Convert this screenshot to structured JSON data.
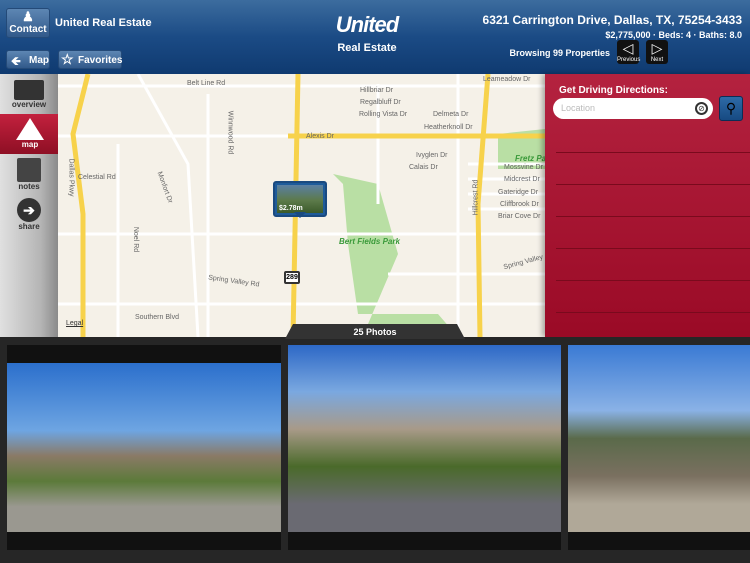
{
  "header": {
    "contact_label": "Contact",
    "agent_name": "United Real Estate",
    "map_label": "Map",
    "favorites_label": "Favorites",
    "logo_line1": "United",
    "logo_line2": "Real Estate",
    "address": "6321 Carrington Drive, Dallas, TX, 75254-3433",
    "details": "$2,775,000 · Beds: 4 · Baths: 8.0",
    "browsing": "Browsing 99 Properties",
    "previous_label": "Previous",
    "next_label": "Next"
  },
  "sidebar": {
    "items": [
      {
        "label": "overview",
        "icon": "book-icon"
      },
      {
        "label": "map",
        "icon": "road-icon",
        "active": true
      },
      {
        "label": "notes",
        "icon": "notes-icon"
      },
      {
        "label": "share",
        "icon": "share-arrow-icon"
      }
    ]
  },
  "map": {
    "pin_price": "$2.78m",
    "highway_shield": "289",
    "labels": [
      "Belt Line Rd",
      "Winnwood Rd",
      "Dallas Pkwy",
      "Celestial Rd",
      "Monfort Dr",
      "Noel Rd",
      "Spring Valley Rd",
      "Southern Blvd",
      "Hillbriar Dr",
      "Regalbluff Dr",
      "Rolling Vista Dr",
      "Delmeta Dr",
      "Heatherknoll Dr",
      "Alexis Dr",
      "Ivyglen Dr",
      "Calais Dr",
      "Mossvine Dr",
      "Midcrest Dr",
      "Gateridge Dr",
      "Cliffbrook Dr",
      "Briar Cove Dr",
      "Hillcrest Rd",
      "Spring Valley",
      "Leameadow Dr",
      "Legal"
    ],
    "parks": [
      "Bert Fields Park",
      "Fretz Pa"
    ]
  },
  "directions": {
    "title": "Get Driving Directions:",
    "location_placeholder": "Location"
  },
  "photos": {
    "count_label": "25 Photos"
  },
  "colors": {
    "header_blue": "#1b4b85",
    "accent_red": "#a5122d"
  }
}
